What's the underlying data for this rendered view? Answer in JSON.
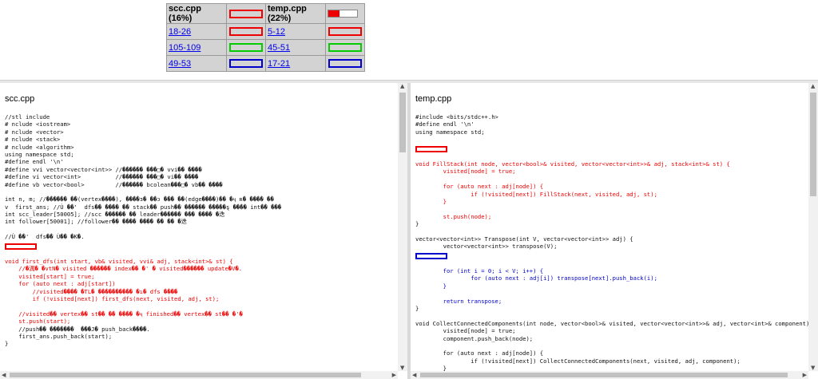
{
  "summary": {
    "left_header": "scc.cpp (16%)",
    "right_header": "temp.cpp (22%)",
    "left_percent": 16,
    "right_percent": 22,
    "rows": [
      {
        "left": "18-26",
        "right": "5-12",
        "color": "red"
      },
      {
        "left": "105-109",
        "right": "45-51",
        "color": "green"
      },
      {
        "left": "49-53",
        "right": "17-21",
        "color": "blue"
      }
    ]
  },
  "left_pane": {
    "title": "scc.cpp",
    "lines": [
      {
        "t": "//stl include"
      },
      {
        "t": "# nclude <iostream>"
      },
      {
        "t": "# nclude <vector>"
      },
      {
        "t": "# nclude <stack>"
      },
      {
        "t": "# nclude <algorithm>"
      },
      {
        "t": "using namespace std;"
      },
      {
        "t": "#define endl '\\n'"
      },
      {
        "t": "#define vvi vector<vector<int>> //������ ���□� vvi�� ����"
      },
      {
        "t": "#define vi vector<int>          //������ ���□� vi�� ����"
      },
      {
        "t": "#define vb vector<bool>         //������ bcolean���□� vb�� ����"
      },
      {
        "t": ""
      },
      {
        "t": "int n, m; //������ ��(vertex����), ����ɜ� ��ɔ ��� ��(edge����)�� �ҷ ʀ� ���� ��"
      },
      {
        "t": "v  first_ans; //Ù ��'  dfs�� ���� �� stack�� push�� ������ �����ȿ ���� int�� ���"
      },
      {
        "t": "int scc_leader[50005]; //scc ������ �� leader������ ��� ���� �迭"
      },
      {
        "t": "int follower[50001]; //follower�� ���� ���� �� �� �迭"
      },
      {
        "t": ""
      },
      {
        "t": "//Ù ��'  dfs�� Ù�� �K�."
      },
      {
        "t": "",
        "marker": "red"
      },
      {
        "t": ""
      },
      {
        "t": "void first_dfs(int start, vb& visited, vvi& adj, stack<int>& st) {",
        "c": "red"
      },
      {
        "t": "    //�湡� �vtN� visited ������ index�� �' � visited������ update�V�.",
        "c": "red"
      },
      {
        "t": "    visited[start] = true;",
        "c": "red"
      },
      {
        "t": "    for (auto next : adj[start])",
        "c": "red"
      },
      {
        "t": "        //visited���� �TL� ���������� �ɿ� dfs ����",
        "c": "red"
      },
      {
        "t": "        if (!visited[next]) first_dfs(next, visited, adj, st);",
        "c": "red"
      },
      {
        "t": "",
        "c": "red"
      },
      {
        "t": "    //visited�� vertex�� st�� �� ���� �ҷ finished�� vertex�� st�� �'�",
        "c": "red"
      },
      {
        "t": "    st.push(start);",
        "c": "red"
      },
      {
        "t": "    //push�� �������  ���J� push_back����."
      },
      {
        "t": "    first_ans.push_back(start);"
      },
      {
        "t": "}"
      }
    ]
  },
  "right_pane": {
    "title": "temp.cpp",
    "lines": [
      {
        "t": "#include <bits/stdc++.h>"
      },
      {
        "t": "#define endl '\\n'"
      },
      {
        "t": "using namespace std;"
      },
      {
        "t": ""
      },
      {
        "t": "",
        "marker": "red"
      },
      {
        "t": ""
      },
      {
        "t": "void FillStack(int node, vector<bool>& visited, vector<vector<int>>& adj, stack<int>& st) {",
        "c": "red"
      },
      {
        "t": "        visited[node] = true;",
        "c": "red"
      },
      {
        "t": "",
        "c": "red"
      },
      {
        "t": "        for (auto next : adj[node]) {",
        "c": "red"
      },
      {
        "t": "                if (!visited[next]) FillStack(next, visited, adj, st);",
        "c": "red"
      },
      {
        "t": "        }",
        "c": "red"
      },
      {
        "t": "",
        "c": "red"
      },
      {
        "t": "        st.push(node);",
        "c": "red"
      },
      {
        "t": "}"
      },
      {
        "t": ""
      },
      {
        "t": "vector<vector<int>> Transpose(int V, vector<vector<int>> adj) {"
      },
      {
        "t": "        vector<vector<int>> transpose(V);"
      },
      {
        "t": "",
        "marker": "blue"
      },
      {
        "t": ""
      },
      {
        "t": "        for (int i = 0; i < V; i++) {",
        "c": "blue"
      },
      {
        "t": "                for (auto next : adj[i]) transpose[next].push_back(i);",
        "c": "blue"
      },
      {
        "t": "        }",
        "c": "blue"
      },
      {
        "t": "",
        "c": "blue"
      },
      {
        "t": "        return transpose;",
        "c": "blue"
      },
      {
        "t": "}"
      },
      {
        "t": ""
      },
      {
        "t": "void CollectConnectedComponents(int node, vector<bool>& visited, vector<vector<int>>& adj, vector<int>& component) {"
      },
      {
        "t": "        visited[node] = true;"
      },
      {
        "t": "        component.push_back(node);"
      },
      {
        "t": ""
      },
      {
        "t": "        for (auto next : adj[node]) {"
      },
      {
        "t": "                if (!visited[next]) CollectConnectedComponents(next, visited, adj, component);"
      },
      {
        "t": "        }"
      }
    ]
  },
  "scroll": {
    "left_vertical_fraction": 0.0,
    "right_vertical_fraction": 0.0
  }
}
